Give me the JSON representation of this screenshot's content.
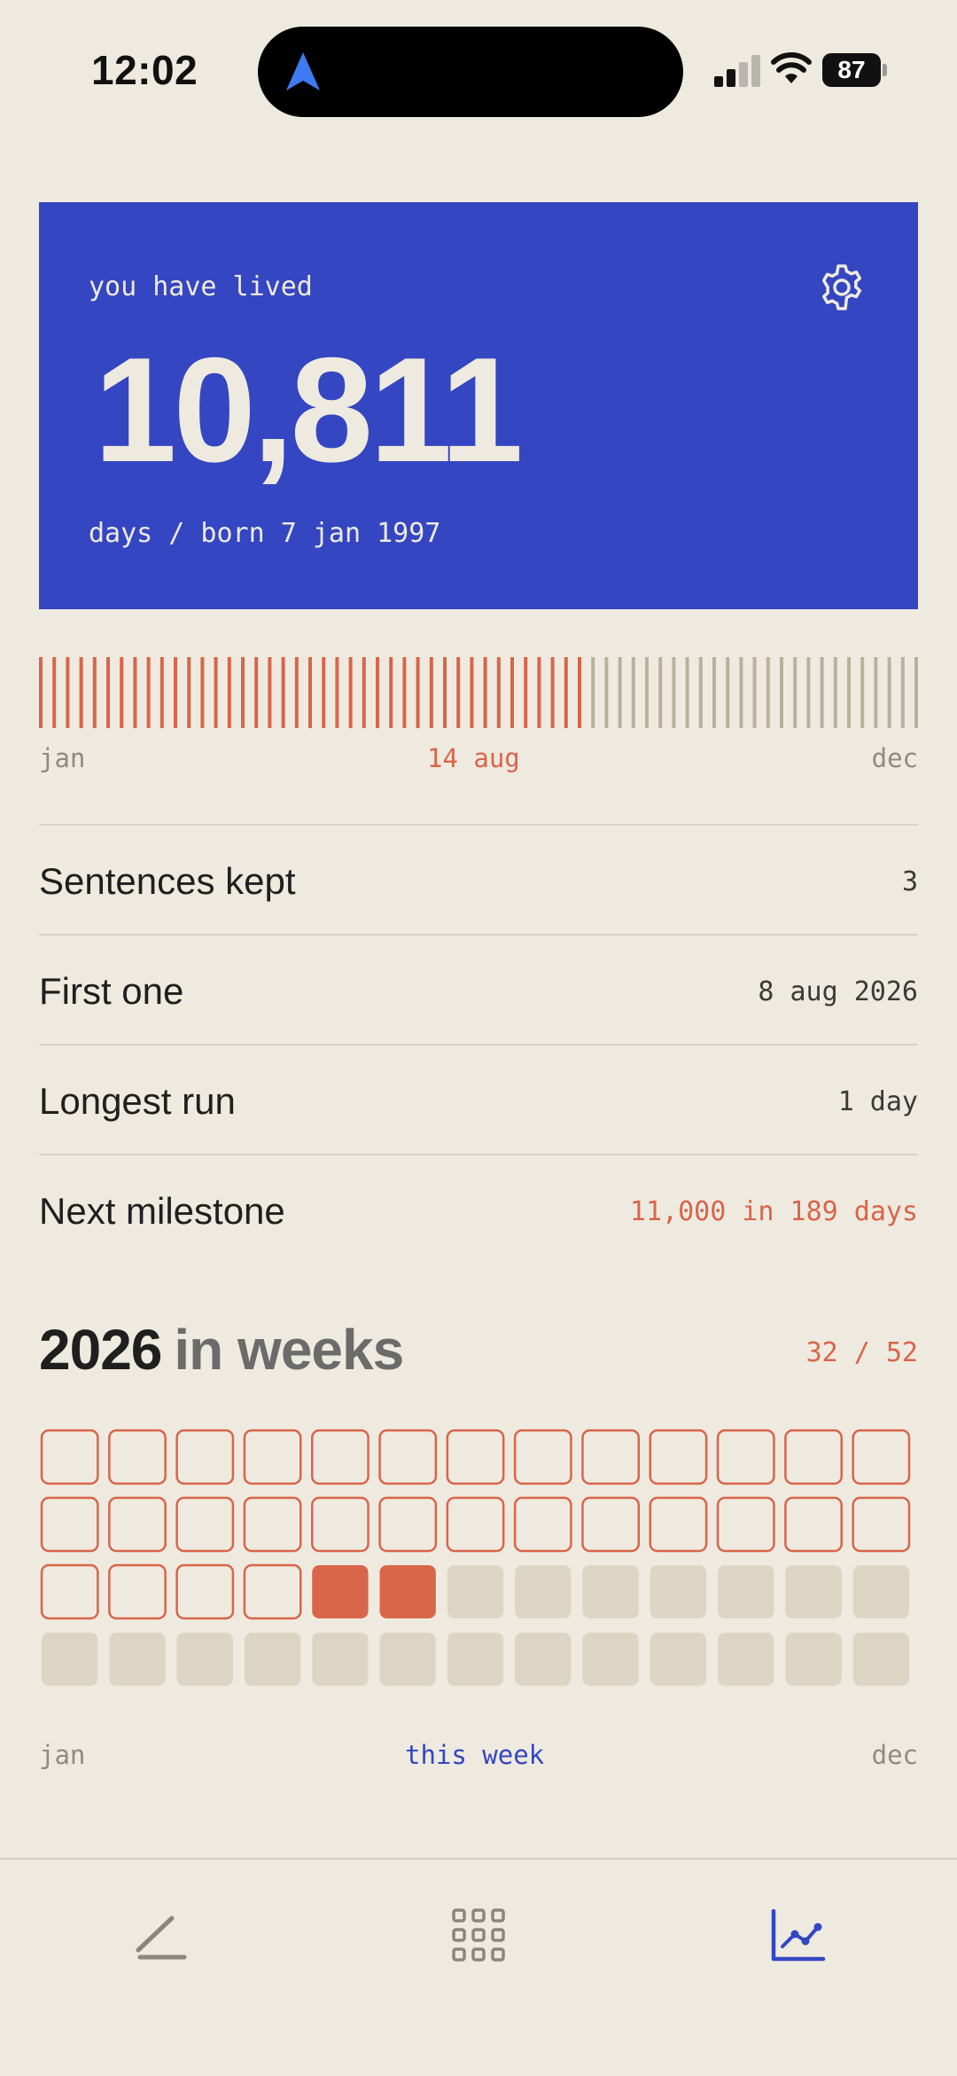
{
  "status_bar": {
    "time": "12:02",
    "battery": "87"
  },
  "hero": {
    "label": "you have lived",
    "days": "10,811",
    "subtitle": "days / born 7 jan 1997",
    "background": "#3446C1"
  },
  "year_progress": {
    "elapsed_fraction": 0.62,
    "start_label": "jan",
    "current_label": "14 aug",
    "end_label": "dec"
  },
  "stats": [
    {
      "label": "Sentences kept",
      "value": "3"
    },
    {
      "label": "First one",
      "value": "8 aug 2026"
    },
    {
      "label": "Longest run",
      "value": "1 day"
    },
    {
      "label": "Next milestone",
      "value": "11,000 in 189 days",
      "highlight": true
    }
  ],
  "weeks": {
    "year": "2026",
    "title_rest": "in weeks",
    "count": "32 / 52",
    "elapsed": 30,
    "current": [
      31,
      32
    ],
    "total": 52,
    "start_label": "jan",
    "current_label": "this week",
    "end_label": "dec"
  },
  "tabs": [
    {
      "icon": "pencil-icon",
      "active": false
    },
    {
      "icon": "grid-icon",
      "active": false
    },
    {
      "icon": "chart-icon",
      "active": true
    }
  ],
  "colors": {
    "accent": "#D9654A",
    "blue": "#3446C1",
    "background": "#EEEADF",
    "future": "#DCD5C4",
    "future_tick": "#B8B19B"
  }
}
